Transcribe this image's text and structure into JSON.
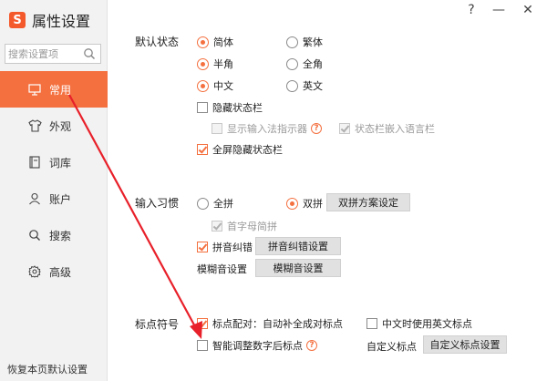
{
  "window": {
    "help_label": "?",
    "minimize_label": "—",
    "close_label": "✕"
  },
  "brand": {
    "logo_text": "S",
    "title": "属性设置"
  },
  "search": {
    "placeholder": "搜索设置项"
  },
  "nav": [
    {
      "label": "常用",
      "icon": "monitor-icon",
      "active": true
    },
    {
      "label": "外观",
      "icon": "shirt-icon"
    },
    {
      "label": "词库",
      "icon": "book-icon"
    },
    {
      "label": "账户",
      "icon": "user-icon"
    },
    {
      "label": "搜索",
      "icon": "search-icon"
    },
    {
      "label": "高级",
      "icon": "gear-icon"
    }
  ],
  "reset_label": "恢复本页默认设置",
  "default_state": {
    "label": "默认状态",
    "simplified": "简体",
    "traditional": "繁体",
    "half_width": "半角",
    "full_width": "全角",
    "chinese": "中文",
    "english": "英文",
    "hide_status_bar": "隐藏状态栏",
    "show_indicator": "显示输入法指示器",
    "embed_lang_bar": "状态栏嵌入语言栏",
    "fullscreen_hide": "全屏隐藏状态栏"
  },
  "input_habit": {
    "label": "输入习惯",
    "full_pinyin": "全拼",
    "double_pinyin": "双拼",
    "double_pinyin_btn": "双拼方案设定",
    "initial_abbrev": "首字母简拼",
    "pinyin_correction": "拼音纠错",
    "pinyin_correction_btn": "拼音纠错设置",
    "fuzzy_label": "模糊音设置",
    "fuzzy_btn": "模糊音设置"
  },
  "punctuation": {
    "label": "标点符号",
    "pair_auto": "标点配对：自动补全成对标点",
    "english_in_chinese": "中文时使用英文标点",
    "smart_digit": "智能调整数字后标点",
    "custom_label": "自定义标点",
    "custom_btn": "自定义标点设置"
  },
  "colors": {
    "accent": "#f4703f",
    "arrow": "#e8202a"
  }
}
